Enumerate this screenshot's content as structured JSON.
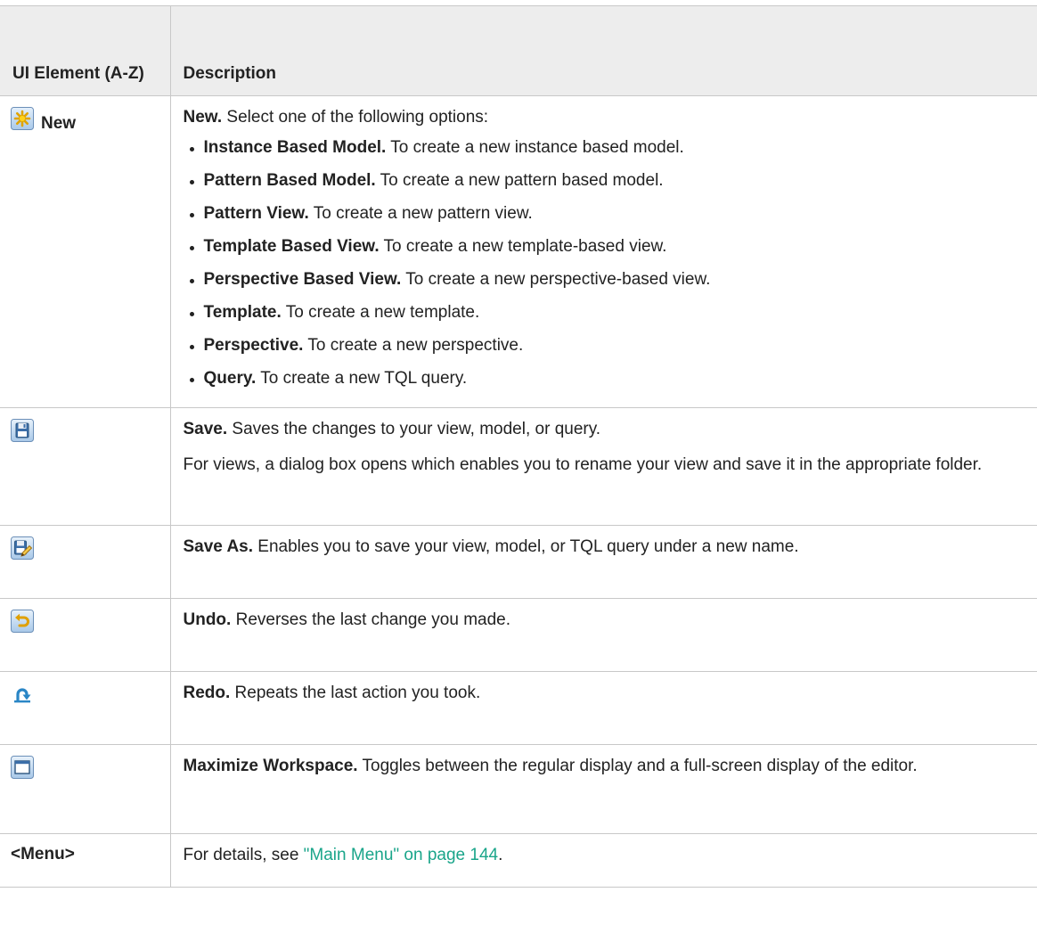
{
  "header": {
    "col1": "UI Element (A-Z)",
    "col2": "Description"
  },
  "rows": {
    "new": {
      "icon": "new-star-icon",
      "label": "New",
      "lead_bold": "New.",
      "lead_text": " Select one of the following options:",
      "options": [
        {
          "name": "Instance Based Model.",
          "text": " To create a new instance based model."
        },
        {
          "name": "Pattern Based Model.",
          "text": " To create a new pattern based model."
        },
        {
          "name": "Pattern View.",
          "text": " To create a new pattern view."
        },
        {
          "name": "Template Based View.",
          "text": " To create a new template-based view."
        },
        {
          "name": "Perspective Based View.",
          "text": " To create a new perspective-based view."
        },
        {
          "name": "Template.",
          "text": " To create a new template."
        },
        {
          "name": "Perspective.",
          "text": " To create a new perspective."
        },
        {
          "name": "Query.",
          "text": " To create a new TQL query."
        }
      ]
    },
    "save": {
      "icon": "save-floppy-icon",
      "bold": "Save.",
      "text": " Saves the changes to your view, model, or query.",
      "extra": "For views, a dialog box opens which enables you to rename your view and save it in the appropriate folder."
    },
    "save_as": {
      "icon": "save-as-icon",
      "bold": "Save As.",
      "text": " Enables you to save your view, model, or TQL query under a new name."
    },
    "undo": {
      "icon": "undo-icon",
      "bold": "Undo.",
      "text": " Reverses the last change you made."
    },
    "redo": {
      "icon": "redo-icon",
      "bold": "Redo.",
      "text": " Repeats the last action you took."
    },
    "maximize": {
      "icon": "maximize-workspace-icon",
      "bold": "Maximize Workspace.",
      "text": " Toggles between the regular display and a full-screen display of the editor."
    },
    "menu": {
      "label": "<Menu>",
      "text_before": "For details, see ",
      "link": "\"Main Menu\" on page 144",
      "text_after": "."
    }
  },
  "colors": {
    "header_bg": "#ededed",
    "border": "#c8c8c8",
    "link": "#1aa58a"
  }
}
